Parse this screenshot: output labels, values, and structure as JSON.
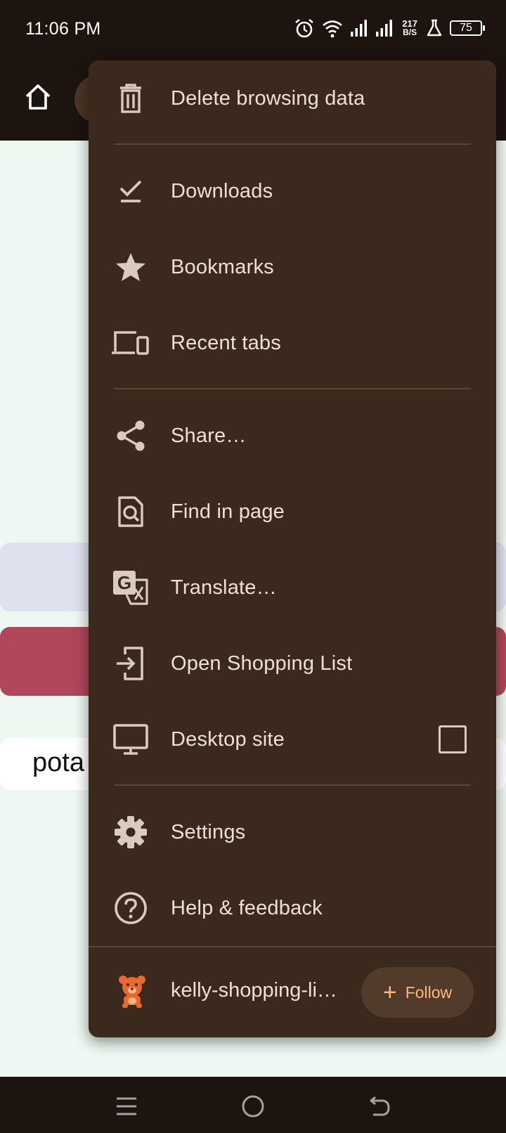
{
  "status_bar": {
    "time": "11:06 PM",
    "net_speed_value": "217",
    "net_speed_unit": "B/S",
    "battery": "75"
  },
  "page": {
    "item_text": "pota"
  },
  "menu": {
    "delete_browsing_data": "Delete browsing data",
    "downloads": "Downloads",
    "bookmarks": "Bookmarks",
    "recent_tabs": "Recent tabs",
    "share": "Share…",
    "find_in_page": "Find in page",
    "translate": "Translate…",
    "open_shopping_list": "Open Shopping List",
    "desktop_site": "Desktop site",
    "desktop_site_checked": false,
    "settings": "Settings",
    "help_feedback": "Help & feedback",
    "site_name": "kelly-shopping-li…",
    "follow_label": "Follow"
  },
  "colors": {
    "menu_bg": "#3b291e",
    "menu_text": "#ede0d5",
    "follow_accent": "#ffb77a",
    "app_bar": "#1d1410"
  },
  "icons": [
    "trash-icon",
    "download-icon",
    "star-icon",
    "devices-icon",
    "share-icon",
    "find-in-page-icon",
    "translate-icon",
    "open-in-icon",
    "monitor-icon",
    "gear-icon",
    "help-icon",
    "bear-icon",
    "home-icon"
  ]
}
